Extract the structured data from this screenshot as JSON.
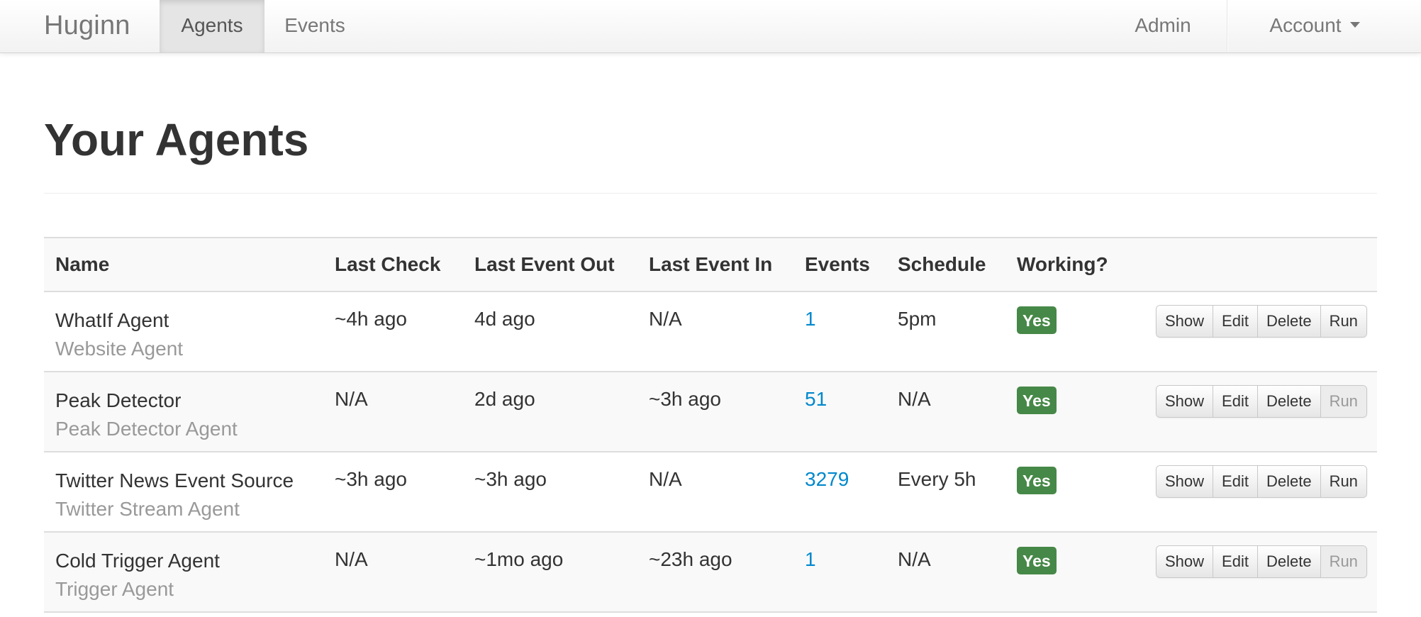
{
  "navbar": {
    "brand": "Huginn",
    "agents_label": "Agents",
    "events_label": "Events",
    "admin_label": "Admin",
    "account_label": "Account"
  },
  "page": {
    "title": "Your Agents"
  },
  "table": {
    "headers": {
      "name": "Name",
      "last_check": "Last Check",
      "last_event_out": "Last Event Out",
      "last_event_in": "Last Event In",
      "events": "Events",
      "schedule": "Schedule",
      "working": "Working?"
    },
    "actions": {
      "show": "Show",
      "edit": "Edit",
      "delete": "Delete",
      "run": "Run"
    },
    "rows": [
      {
        "name": "WhatIf Agent",
        "type": "Website Agent",
        "last_check": "~4h ago",
        "last_event_out": "4d ago",
        "last_event_in": "N/A",
        "events": "1",
        "schedule": "5pm",
        "working": "Yes",
        "run_enabled": true
      },
      {
        "name": "Peak Detector",
        "type": "Peak Detector Agent",
        "last_check": "N/A",
        "last_event_out": "2d ago",
        "last_event_in": "~3h ago",
        "events": "51",
        "schedule": "N/A",
        "working": "Yes",
        "run_enabled": false
      },
      {
        "name": "Twitter News Event Source",
        "type": "Twitter Stream Agent",
        "last_check": "~3h ago",
        "last_event_out": "~3h ago",
        "last_event_in": "N/A",
        "events": "3279",
        "schedule": "Every 5h",
        "working": "Yes",
        "run_enabled": true
      },
      {
        "name": "Cold Trigger Agent",
        "type": "Trigger Agent",
        "last_check": "N/A",
        "last_event_out": "~1mo ago",
        "last_event_in": "~23h ago",
        "events": "1",
        "schedule": "N/A",
        "working": "Yes",
        "run_enabled": false
      }
    ]
  },
  "colors": {
    "link": "#0088cc",
    "success_badge": "#468847",
    "muted_text": "#999999"
  }
}
